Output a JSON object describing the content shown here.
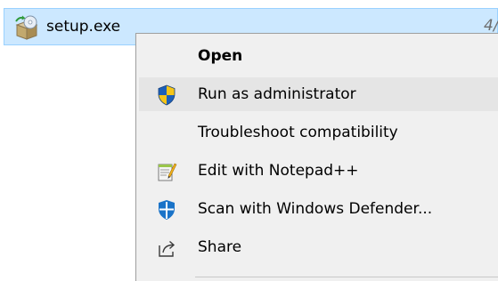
{
  "file": {
    "name": "setup.exe",
    "date_fragment": "4/",
    "icon": "installer-icon"
  },
  "context_menu": {
    "items": [
      {
        "label": "Open",
        "icon": null,
        "bold": true
      },
      {
        "label": "Run as administrator",
        "icon": "uac-shield-icon",
        "highlighted": true
      },
      {
        "label": "Troubleshoot compatibility",
        "icon": null
      },
      {
        "label": "Edit with Notepad++",
        "icon": "notepad-plus-plus-icon"
      },
      {
        "label": "Scan with Windows Defender...",
        "icon": "windows-defender-icon"
      },
      {
        "label": "Share",
        "icon": "share-icon"
      }
    ]
  },
  "colors": {
    "selection_background": "#cce8ff",
    "selection_border": "#99d1ff",
    "menu_background": "#f0f0f0",
    "menu_highlight": "#e5e5e5",
    "shield_blue": "#1c5fb8",
    "shield_yellow": "#f5c518",
    "defender_blue": "#1a73c8"
  }
}
